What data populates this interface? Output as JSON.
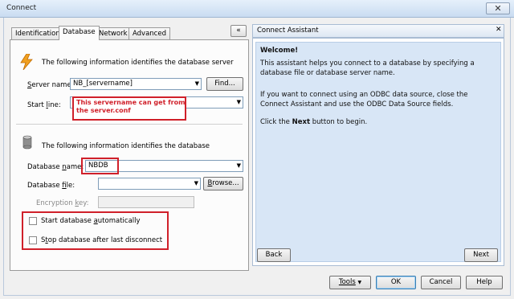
{
  "window": {
    "title": "Connect",
    "close_glyph": "✕"
  },
  "tabs": [
    {
      "label": "Identification",
      "active": false
    },
    {
      "label": "Database",
      "active": true
    },
    {
      "label": "Network",
      "active": false
    },
    {
      "label": "Advanced",
      "active": false
    }
  ],
  "collapse_glyph": "«",
  "server_section": {
    "icon": "lightning-icon",
    "heading": "The following information identifies the database server",
    "server_name_label_u": "S",
    "server_name_label_rest": "erver name:",
    "server_name_value": "NB_[servername]",
    "find_button": "Find...",
    "start_line_label_pre": "Start ",
    "start_line_label_u": "l",
    "start_line_label_post": "ine:",
    "start_line_value": ""
  },
  "annotation": {
    "note_line1": "This servername can get from",
    "note_line2": "the server.conf"
  },
  "database_section": {
    "icon": "database-icon",
    "heading": "The following information identifies the database",
    "db_name_label_pre": "Database ",
    "db_name_label_u": "n",
    "db_name_label_post": "ame:",
    "db_name_value": "NBDB",
    "db_file_label_pre": "Database ",
    "db_file_label_u": "f",
    "db_file_label_post": "ile:",
    "db_file_value": "",
    "browse_button_u": "B",
    "browse_button_rest": "rowse...",
    "encryption_label_pre": "Encryption ",
    "encryption_label_u": "k",
    "encryption_label_post": "ey:",
    "encryption_value": "",
    "start_auto_pre": "Start database ",
    "start_auto_u": "a",
    "start_auto_post": "utomatically",
    "start_auto_checked": false,
    "stop_disconnect_pre": "S",
    "stop_disconnect_u": "t",
    "stop_disconnect_post": "op database after last disconnect",
    "stop_disconnect_checked": false
  },
  "assistant": {
    "title": "Connect Assistant",
    "close_glyph": "✕",
    "welcome": "Welcome!",
    "para1": "This assistant helps you connect to a database by specifying a database file or database server name.",
    "para2": "If you want to connect using an ODBC data source, close the Connect Assistant and use the ODBC Data Source fields.",
    "para3_pre": "Click the ",
    "para3_bold": "Next",
    "para3_post": " button to begin.",
    "back_button": "Back",
    "next_button": "Next"
  },
  "footer": {
    "tools_button": "Tools",
    "ok_button": "OK",
    "cancel_button": "Cancel",
    "help_button": "Help"
  },
  "colors": {
    "annotation_red": "#d0202a",
    "assistant_bg": "#d8e6f6",
    "titlebar": "#c9dcf1"
  }
}
